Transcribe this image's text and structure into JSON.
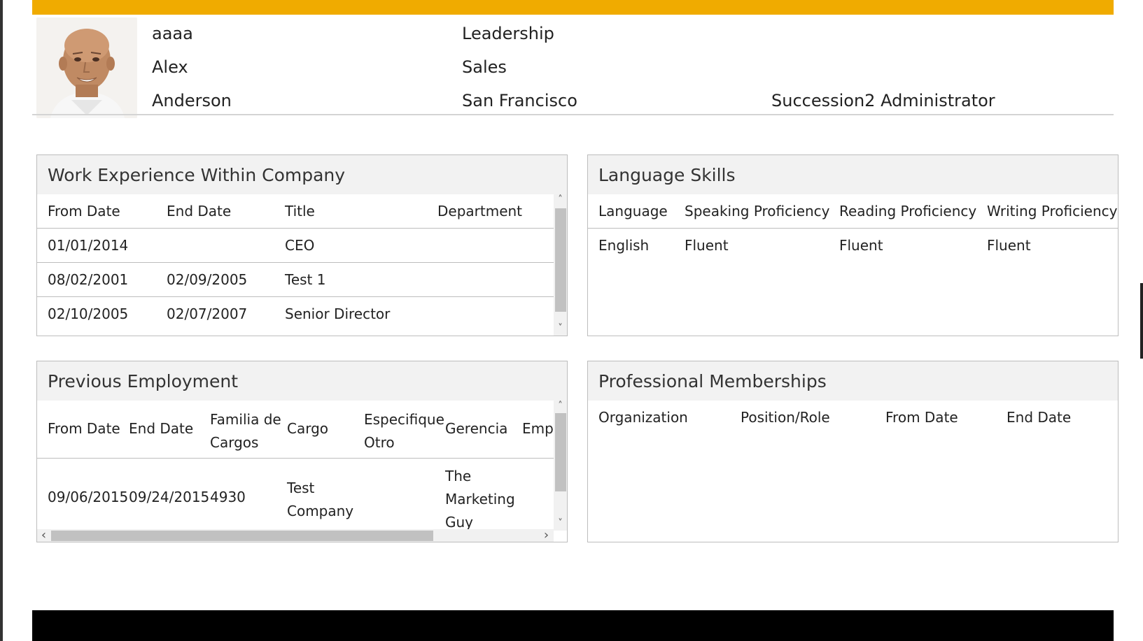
{
  "header": {
    "field_1": "aaaa",
    "first_name": "Alex",
    "last_name": "Anderson",
    "level": "Leadership",
    "department": "Sales",
    "location": "San Francisco",
    "role": "Succession2 Administrator"
  },
  "work_experience": {
    "title": "Work Experience Within Company",
    "columns": [
      "From Date",
      "End Date",
      "Title",
      "Department"
    ],
    "rows": [
      [
        "01/01/2014",
        "",
        "CEO",
        ""
      ],
      [
        "08/02/2001",
        "02/09/2005",
        "Test 1",
        ""
      ],
      [
        "02/10/2005",
        "02/07/2007",
        "Senior Director",
        ""
      ]
    ]
  },
  "language_skills": {
    "title": "Language Skills",
    "columns": [
      "Language",
      "Speaking Proficiency",
      "Reading Proficiency",
      "Writing Proficiency"
    ],
    "rows": [
      [
        "English",
        "Fluent",
        "Fluent",
        "Fluent"
      ]
    ]
  },
  "previous_employment": {
    "title": "Previous Employment",
    "columns": [
      "From Date",
      "End Date",
      "Familia de\nCargos",
      "Cargo",
      "Especifique\nOtro",
      "Gerencia",
      "Empr"
    ],
    "rows": [
      [
        "09/06/2015",
        "09/24/2015",
        "4930",
        "Test\nCompany",
        "",
        "The\nMarketing\nGuy",
        ""
      ]
    ]
  },
  "professional_memberships": {
    "title": "Professional Memberships",
    "columns": [
      "Organization",
      "Position/Role",
      "From Date",
      "End Date"
    ]
  },
  "scroll": {
    "up": "˄",
    "down": "˅",
    "left": "‹",
    "right": "›"
  },
  "icons": {
    "photo": "profile-photo",
    "arrows": "scroll-arrow-icons"
  }
}
